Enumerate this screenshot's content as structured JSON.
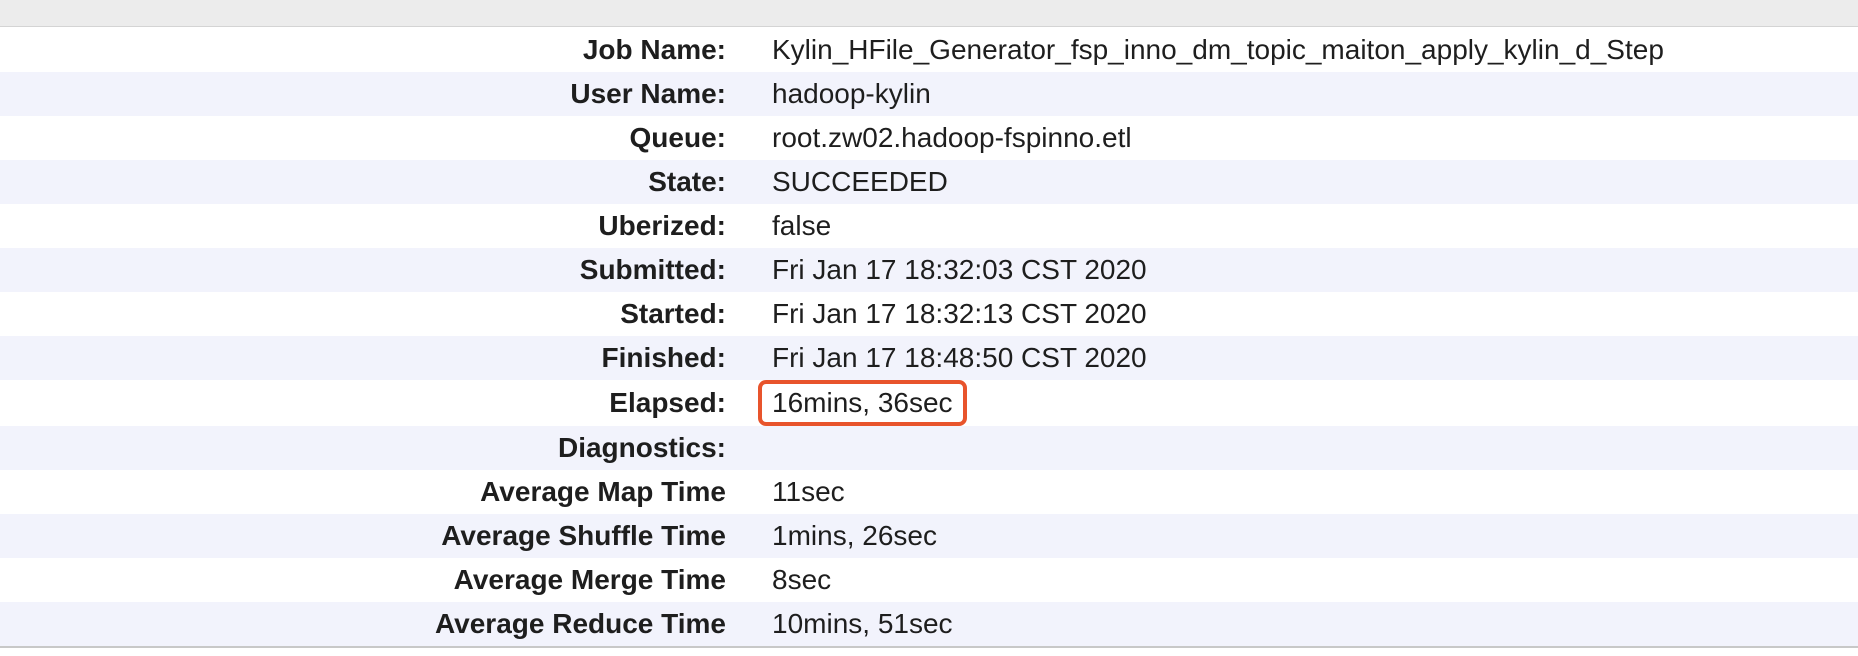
{
  "job_overview": {
    "rows": [
      {
        "label": "Job Name:",
        "value": "Kylin_HFile_Generator_fsp_inno_dm_topic_maiton_apply_kylin_d_Step"
      },
      {
        "label": "User Name:",
        "value": "hadoop-kylin"
      },
      {
        "label": "Queue:",
        "value": "root.zw02.hadoop-fspinno.etl"
      },
      {
        "label": "State:",
        "value": "SUCCEEDED"
      },
      {
        "label": "Uberized:",
        "value": "false"
      },
      {
        "label": "Submitted:",
        "value": "Fri Jan 17 18:32:03 CST 2020"
      },
      {
        "label": "Started:",
        "value": "Fri Jan 17 18:32:13 CST 2020"
      },
      {
        "label": "Finished:",
        "value": "Fri Jan 17 18:48:50 CST 2020"
      },
      {
        "label": "Elapsed:",
        "value": "16mins, 36sec",
        "highlighted": true
      },
      {
        "label": "Diagnostics:",
        "value": ""
      },
      {
        "label": "Average Map Time",
        "value": "11sec"
      },
      {
        "label": "Average Shuffle Time",
        "value": "1mins, 26sec"
      },
      {
        "label": "Average Merge Time",
        "value": "8sec"
      },
      {
        "label": "Average Reduce Time",
        "value": "10mins, 51sec"
      }
    ]
  },
  "colors": {
    "highlight_border": "#e8542c",
    "row_alt_background": "#f2f3fc"
  }
}
